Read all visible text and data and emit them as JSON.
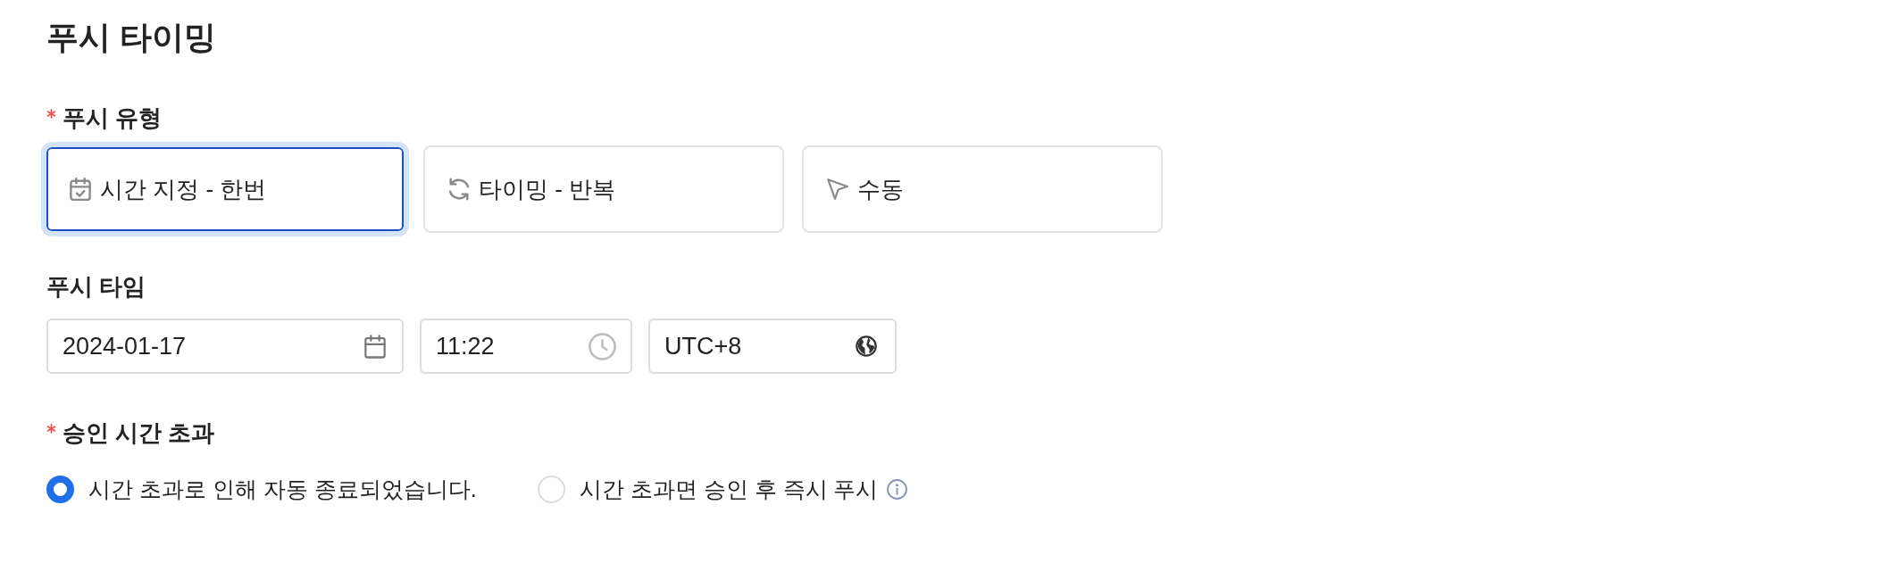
{
  "title": "푸시 타이밍",
  "push_type": {
    "label": "푸시 유형",
    "required": true,
    "options": [
      {
        "label": "시간 지정 - 한번",
        "kind": "calendar",
        "selected": true
      },
      {
        "label": "타이밍 - 반복",
        "kind": "repeat",
        "selected": false
      },
      {
        "label": "수동",
        "kind": "pointer",
        "selected": false
      }
    ]
  },
  "push_time": {
    "label": "푸시 타임",
    "required": false,
    "fields": [
      {
        "value": "2024-01-17",
        "kind": "date"
      },
      {
        "value": "11:22",
        "kind": "time"
      },
      {
        "value": "UTC+8",
        "kind": "timezone"
      }
    ]
  },
  "approval_timeout": {
    "label": "승인 시간 초과",
    "required": true,
    "options": [
      {
        "label": "시간 초과로 인해 자동 종료되었습니다.",
        "selected": true,
        "info": false
      },
      {
        "label": "시간 초과면 승인 후 즉시 푸시",
        "selected": false,
        "info": true
      }
    ]
  }
}
